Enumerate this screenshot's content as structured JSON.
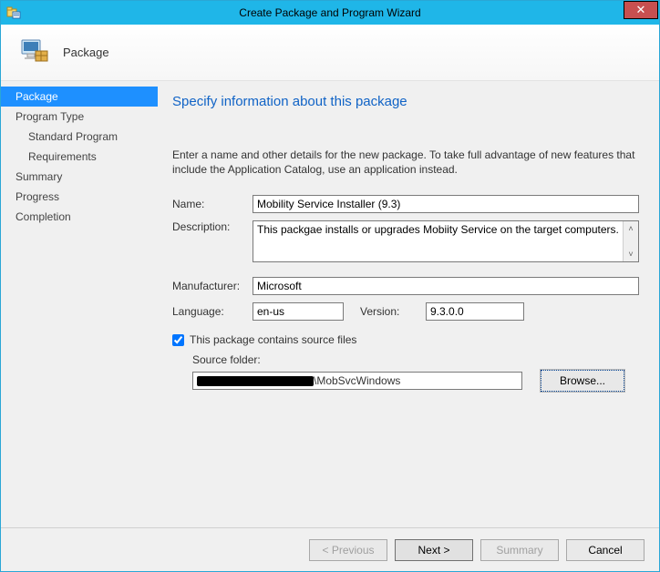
{
  "window": {
    "title": "Create Package and Program Wizard"
  },
  "header": {
    "title": "Package"
  },
  "sidebar": {
    "items": [
      {
        "label": "Package",
        "selected": true,
        "sub": false
      },
      {
        "label": "Program Type",
        "selected": false,
        "sub": false
      },
      {
        "label": "Standard Program",
        "selected": false,
        "sub": true
      },
      {
        "label": "Requirements",
        "selected": false,
        "sub": true
      },
      {
        "label": "Summary",
        "selected": false,
        "sub": false
      },
      {
        "label": "Progress",
        "selected": false,
        "sub": false
      },
      {
        "label": "Completion",
        "selected": false,
        "sub": false
      }
    ]
  },
  "content": {
    "heading": "Specify information about this package",
    "intro": "Enter a name and other details for the new package. To take full advantage of new features that include the Application Catalog, use an application instead.",
    "labels": {
      "name": "Name:",
      "description": "Description:",
      "manufacturer": "Manufacturer:",
      "language": "Language:",
      "version": "Version:",
      "sourceCheckbox": "This package contains source files",
      "sourceFolder": "Source folder:",
      "browse": "Browse..."
    },
    "values": {
      "name": "Mobility Service Installer (9.3)",
      "description": "This packgae installs or upgrades Mobiity Service on the target computers.",
      "manufacturer": "Microsoft",
      "language": "en-us",
      "version": "9.3.0.0",
      "sourceContains": true,
      "sourceFolderSuffix": "\\MobSvcWindows"
    }
  },
  "footer": {
    "previous": "< Previous",
    "next": "Next >",
    "summary": "Summary",
    "cancel": "Cancel"
  }
}
